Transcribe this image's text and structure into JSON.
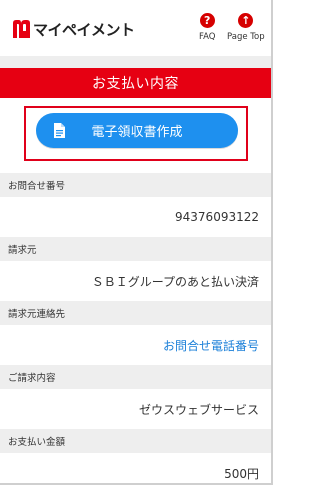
{
  "header": {
    "logo_text": "マイペイメント",
    "faq_label": "FAQ",
    "page_top_label": "Page Top",
    "faq_icon": "?",
    "page_top_icon": "↑"
  },
  "page": {
    "title": "お支払い内容"
  },
  "receipt_button": {
    "label": "電子領収書作成",
    "icon": "document-icon"
  },
  "fields": [
    {
      "label": "お問合せ番号",
      "value": "94376093122",
      "is_link": false
    },
    {
      "label": "請求元",
      "value": "ＳＢＩグループのあと払い決済",
      "is_link": false
    },
    {
      "label": "請求元連絡先",
      "value": "お問合せ電話番号",
      "is_link": true
    },
    {
      "label": "ご請求内容",
      "value": "ゼウスウェブサービス",
      "is_link": false
    },
    {
      "label": "お支払い金額",
      "value": "500円",
      "is_link": false
    }
  ],
  "colors": {
    "brand_red": "#e60012",
    "button_blue": "#1e90ef",
    "link_blue": "#1a7fd8",
    "section_gray": "#eeeeee"
  }
}
